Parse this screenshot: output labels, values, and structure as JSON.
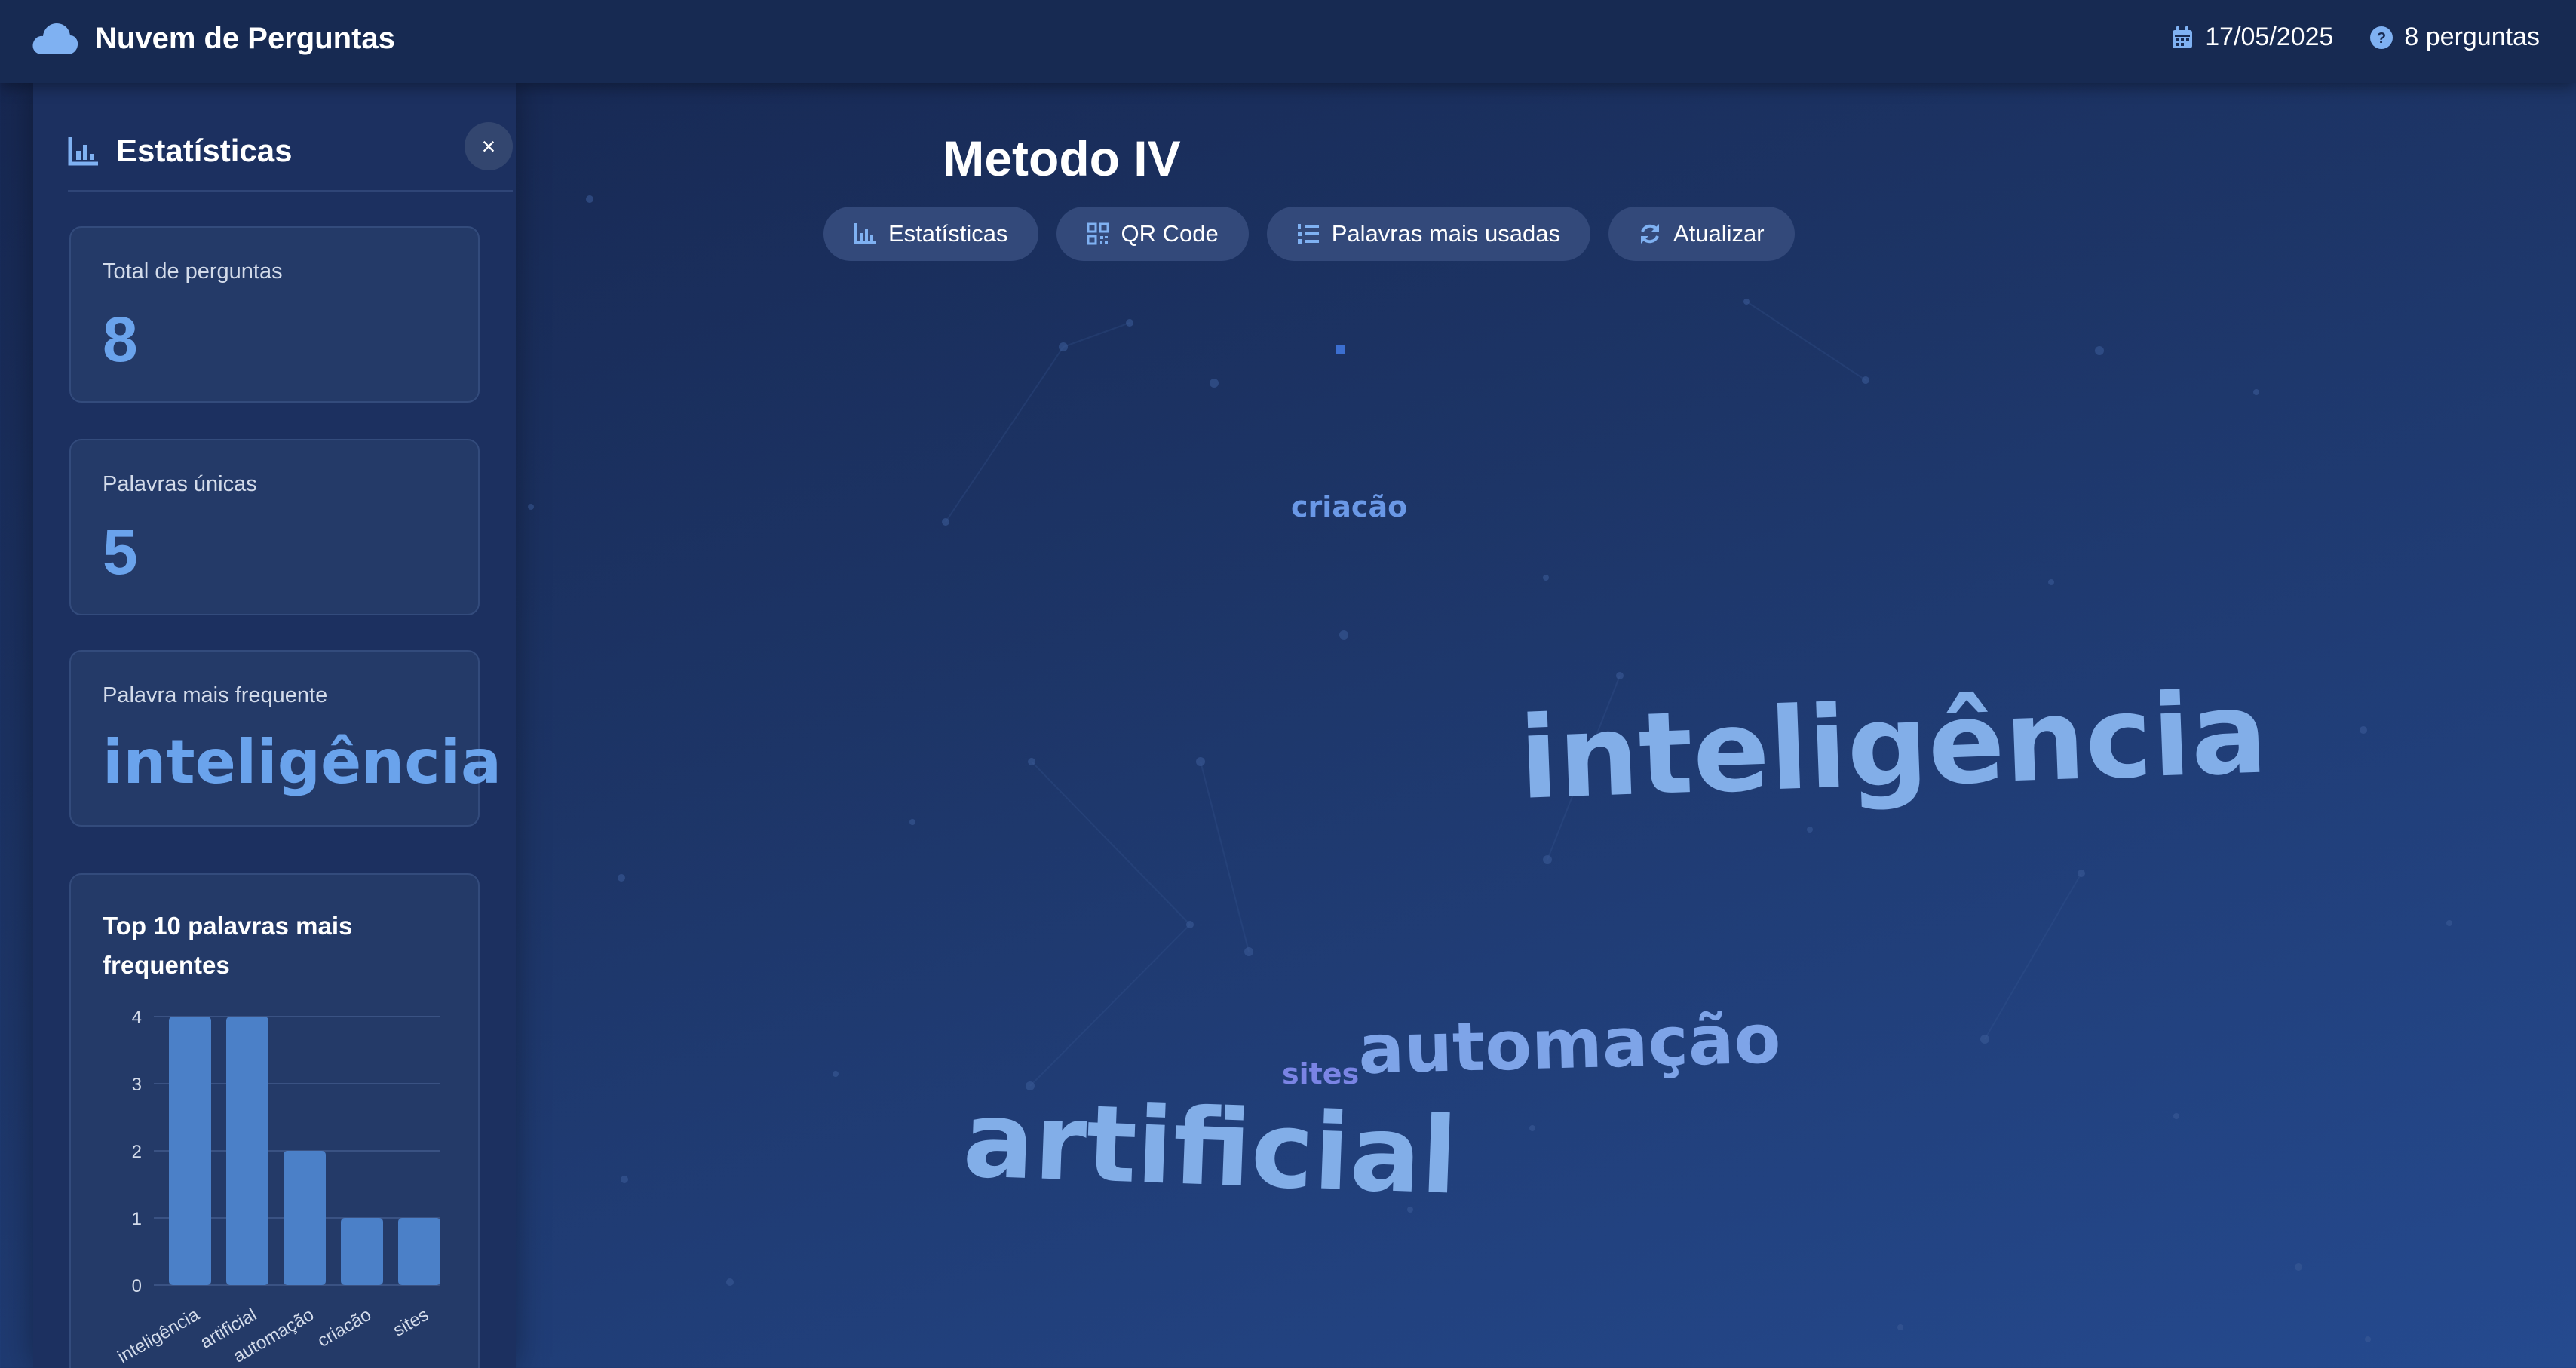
{
  "header": {
    "app_title": "Nuvem de Perguntas",
    "date": "17/05/2025",
    "question_count": "8 perguntas"
  },
  "sidebar": {
    "title": "Estatísticas",
    "close_label": "×",
    "cards": [
      {
        "label": "Total de perguntas",
        "value": "8"
      },
      {
        "label": "Palavras únicas",
        "value": "5"
      },
      {
        "label": "Palavra mais frequente",
        "value": "inteligência"
      }
    ],
    "chart_title": "Top 10 palavras mais frequentes"
  },
  "main": {
    "title": "Metodo IV",
    "toolbar": [
      {
        "label": "Estatísticas",
        "icon": "chart-bar-icon"
      },
      {
        "label": "QR Code",
        "icon": "qrcode-icon"
      },
      {
        "label": "Palavras mais usadas",
        "icon": "list-ol-icon"
      },
      {
        "label": "Atualizar",
        "icon": "refresh-icon"
      }
    ]
  },
  "word_cloud": [
    {
      "text": "criacão",
      "color": "#6a98e6",
      "weight": 1
    },
    {
      "text": "inteligência",
      "color": "#82aee8",
      "weight": 4
    },
    {
      "text": "automação",
      "color": "#7ea4e8",
      "weight": 2
    },
    {
      "text": "sites",
      "color": "#7a84e4",
      "weight": 1
    },
    {
      "text": "artificial",
      "color": "#82aee8",
      "weight": 4
    }
  ],
  "colors": {
    "accent": "#6aa3ec",
    "bar": "#4b80c8",
    "background": "#1d3567"
  },
  "chart_data": {
    "type": "bar",
    "title": "Top 10 palavras mais frequentes",
    "categories": [
      "inteligência",
      "artificial",
      "automação",
      "criacão",
      "sites"
    ],
    "values": [
      4,
      4,
      2,
      1,
      1
    ],
    "ylim": [
      0,
      4
    ],
    "yticks": [
      "0",
      "1",
      "2",
      "3",
      "4"
    ],
    "grid": true
  }
}
